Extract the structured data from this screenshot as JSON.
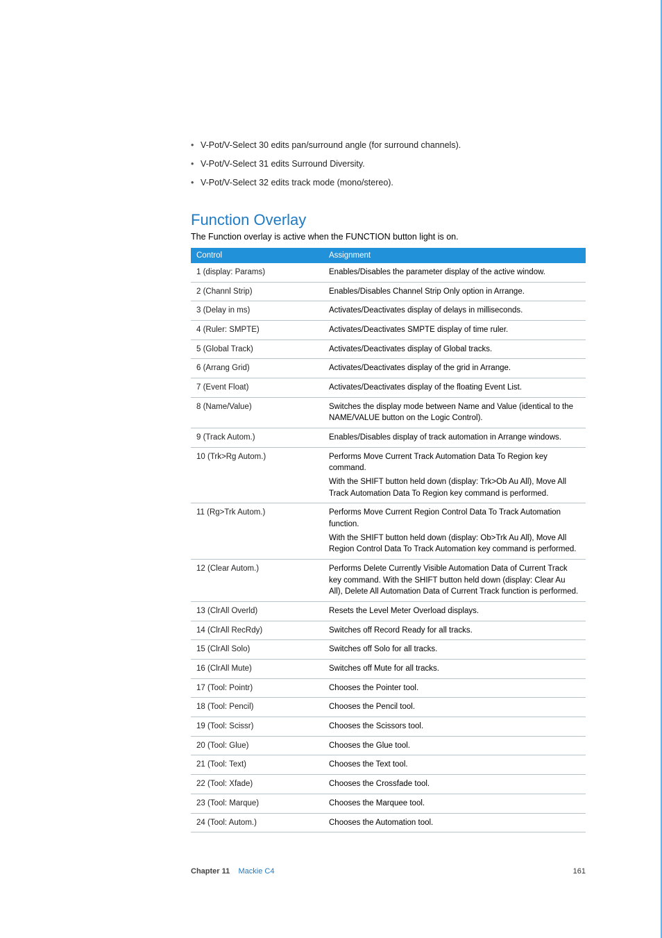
{
  "bullets": [
    "V-Pot/V-Select 30 edits pan/surround angle (for surround channels).",
    "V-Pot/V-Select 31 edits Surround Diversity.",
    "V-Pot/V-Select 32 edits track mode (mono/stereo)."
  ],
  "section_heading": "Function Overlay",
  "section_intro": "The Function overlay is active when the FUNCTION button light is on.",
  "table": {
    "header": {
      "control": "Control",
      "assignment": "Assignment"
    },
    "rows": [
      {
        "control": "1 (display:  Params)",
        "assignment": "Enables/Disables the parameter display of the active window."
      },
      {
        "control": "2 (Channl Strip)",
        "assignment": "Enables/Disables Channel Strip Only option in Arrange."
      },
      {
        "control": "3 (Delay in ms)",
        "assignment": "Activates/Deactivates display of delays in milliseconds."
      },
      {
        "control": "4 (Ruler:  SMPTE)",
        "assignment": "Activates/Deactivates SMPTE display of time ruler."
      },
      {
        "control": "5 (Global Track)",
        "assignment": "Activates/Deactivates display of Global tracks."
      },
      {
        "control": "6 (Arrang Grid)",
        "assignment": "Activates/Deactivates display of the grid in Arrange."
      },
      {
        "control": "7 (Event Float)",
        "assignment": "Activates/Deactivates display of the floating Event List."
      },
      {
        "control": "8 (Name/Value)",
        "assignment": "Switches the display mode between Name and Value (identical to the NAME/VALUE button on the Logic Control)."
      },
      {
        "control": "9 (Track Autom.)",
        "assignment": "Enables/Disables display of track automation in Arrange windows."
      },
      {
        "control": "10 (Trk>Rg Autom.)",
        "assignment": "Performs Move Current Track Automation Data To Region key command.",
        "sub": "With the SHIFT button held down (display:  Trk>Ob Au All), Move All Track Automation Data To Region key command is performed."
      },
      {
        "control": "11 (Rg>Trk Autom.)",
        "assignment": "Performs Move Current Region Control Data To Track Automation function.",
        "sub": "With the SHIFT button held down (display:  Ob>Trk Au All), Move All Region Control Data To Track Automation key command is performed."
      },
      {
        "control": "12 (Clear Autom.)",
        "assignment": "Performs Delete Currently Visible Automation Data of Current Track key command. With the SHIFT button held down (display:  Clear Au All), Delete All Automation Data of Current Track function is performed."
      },
      {
        "control": "13 (ClrAll Overld)",
        "assignment": "Resets the Level Meter Overload displays."
      },
      {
        "control": "14 (ClrAll RecRdy)",
        "assignment": "Switches off Record Ready for all tracks."
      },
      {
        "control": "15 (ClrAll Solo)",
        "assignment": "Switches off Solo for all tracks."
      },
      {
        "control": "16 (ClrAll Mute)",
        "assignment": "Switches off Mute for all tracks."
      },
      {
        "control": "17 (Tool:  Pointr)",
        "assignment": "Chooses the Pointer tool."
      },
      {
        "control": "18 (Tool:  Pencil)",
        "assignment": "Chooses the Pencil tool."
      },
      {
        "control": "19 (Tool:  Scissr)",
        "assignment": "Chooses the Scissors tool."
      },
      {
        "control": "20 (Tool:  Glue)",
        "assignment": "Chooses the Glue tool."
      },
      {
        "control": "21 (Tool:  Text)",
        "assignment": "Chooses the Text tool."
      },
      {
        "control": "22 (Tool:  Xfade)",
        "assignment": "Chooses the Crossfade tool."
      },
      {
        "control": "23 (Tool:  Marque)",
        "assignment": "Chooses the Marquee tool."
      },
      {
        "control": "24 (Tool:  Autom.)",
        "assignment": "Chooses the Automation tool."
      }
    ]
  },
  "footer": {
    "chapter_label": "Chapter 11",
    "chapter_link": "Mackie C4",
    "page_number": "161"
  }
}
